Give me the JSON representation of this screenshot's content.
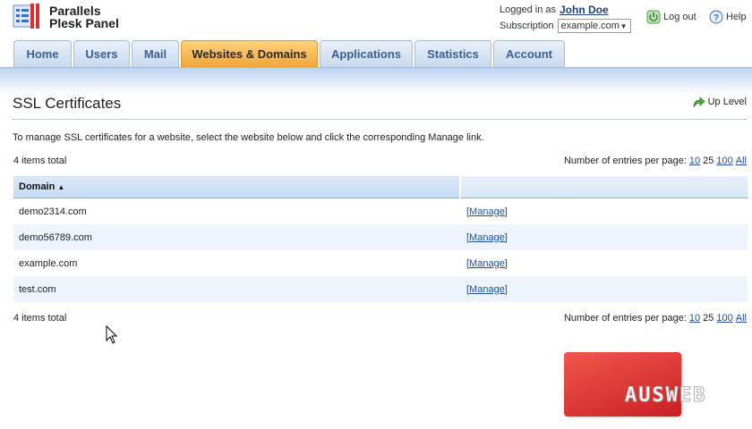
{
  "brand": {
    "line1": "Parallels",
    "line2": "Plesk Panel"
  },
  "user": {
    "logged_in_label": "Logged in as",
    "name": "John Doe",
    "subscription_label": "Subscription",
    "subscription_value": "example.com"
  },
  "top_links": {
    "logout": "Log out",
    "help": "Help"
  },
  "tabs": [
    {
      "label": "Home",
      "active": false
    },
    {
      "label": "Users",
      "active": false
    },
    {
      "label": "Mail",
      "active": false
    },
    {
      "label": "Websites & Domains",
      "active": true
    },
    {
      "label": "Applications",
      "active": false
    },
    {
      "label": "Statistics",
      "active": false
    },
    {
      "label": "Account",
      "active": false
    }
  ],
  "page": {
    "title": "SSL Certificates",
    "up_level": "Up Level",
    "intro": "To manage SSL certificates for a website, select the website below and click the corresponding Manage link."
  },
  "list": {
    "total": "4 items total",
    "paging_label": "Number of entries per page:",
    "paging_options": [
      "10",
      "25",
      "100",
      "All"
    ],
    "paging_current": "25",
    "column_domain": "Domain",
    "rows": [
      {
        "domain": "demo2314.com",
        "action": "[Manage]"
      },
      {
        "domain": "demo56789.com",
        "action": "[Manage]"
      },
      {
        "domain": "example.com",
        "action": "[Manage]"
      },
      {
        "domain": "test.com",
        "action": "[Manage]"
      }
    ]
  },
  "watermark": {
    "text": "AUSWEB"
  },
  "colors": {
    "active_tab": "#f3a53a",
    "tab": "#c9d9ee",
    "link": "#1f4f9a",
    "watermark": "#d8302c"
  }
}
